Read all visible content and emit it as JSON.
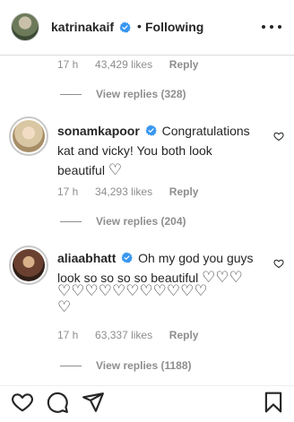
{
  "header": {
    "username": "katrinakaif",
    "separator": "•",
    "follow_status": "Following",
    "more_icon": "more-horizontal-icon"
  },
  "first_comment_meta": {
    "time": "17 h",
    "likes": "43,429 likes",
    "reply": "Reply",
    "view_replies": "View replies (328)"
  },
  "comments": [
    {
      "username": "sonamkapoor",
      "text": "Congratulations kat and vicky! You both look beautiful",
      "line1": "Congratulations",
      "line2": "kat and vicky! You both look",
      "line3": "beautiful",
      "emoji": "♡",
      "time": "17 h",
      "likes": "34,293 likes",
      "reply": "Reply",
      "view_replies": "View replies (204)"
    },
    {
      "username": "aliaabhatt",
      "line1": "Oh my god you guys",
      "line2": "look so so so so beautiful",
      "hearts_line2": "♡♡♡",
      "hearts_line3": "♡♡♡♡♡♡♡♡♡♡♡",
      "hearts_line4": "♡",
      "time": "17 h",
      "likes": "63,337 likes",
      "reply": "Reply",
      "view_replies": "View replies (1188)"
    }
  ],
  "bottom_bar": {
    "icons": [
      "heart-icon",
      "comment-icon",
      "share-icon",
      "bookmark-icon"
    ]
  },
  "colors": {
    "text": "#262626",
    "secondary": "#8e8e8e",
    "verified": "#3897f0",
    "border": "#dbdbdb"
  }
}
